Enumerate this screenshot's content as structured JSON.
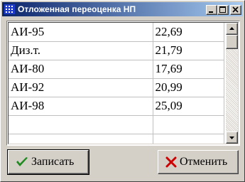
{
  "window": {
    "title": "Отложенная переоценка НП"
  },
  "grid": {
    "rows": [
      {
        "name": "АИ-95",
        "value": "22,69"
      },
      {
        "name": "Диз.т.",
        "value": "21,79"
      },
      {
        "name": "АИ-80",
        "value": "17,69"
      },
      {
        "name": "АИ-92",
        "value": "20,99"
      },
      {
        "name": "АИ-98",
        "value": "25,09"
      },
      {
        "name": "",
        "value": ""
      },
      {
        "name": "",
        "value": ""
      }
    ]
  },
  "buttons": {
    "save_label": "Записать",
    "cancel_label": "Отменить"
  },
  "colors": {
    "titlebar_start": "#0a246a",
    "titlebar_end": "#a6caf0",
    "save_icon": "#1f8a1f",
    "cancel_icon": "#cc0000"
  },
  "icons": {
    "app": "grid-app-icon",
    "save": "check-icon",
    "cancel": "x-icon"
  }
}
